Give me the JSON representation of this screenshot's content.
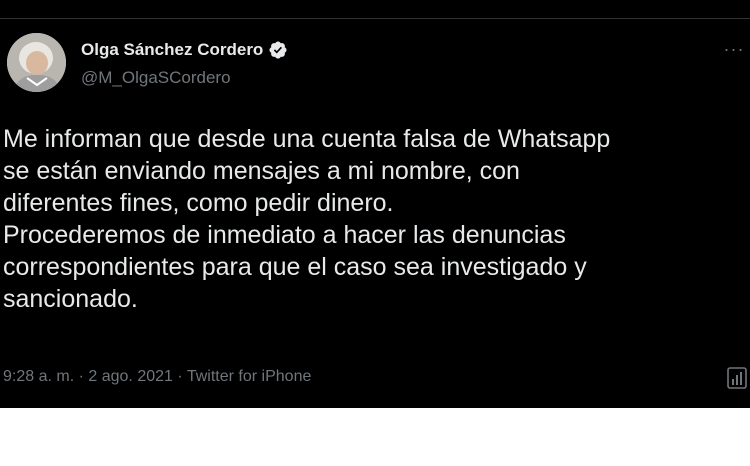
{
  "tweet": {
    "author": {
      "display_name": "Olga Sánchez Cordero",
      "handle": "@M_OlgaSCordero",
      "verified": true,
      "verified_icon": "verified-badge-icon",
      "avatar_icon": "profile-photo"
    },
    "more_icon": "more-options-icon",
    "more_label": "···",
    "text": "Me informan que desde una cuenta falsa de Whatsapp\nse están enviando mensajes a mi nombre, con\ndiferentes fines, como pedir dinero.\nProcederemos de inmediato a hacer las denuncias\ncorrespondientes para que el caso sea investigado y\nsancionado.",
    "time": "9:28 a. m.",
    "separator": "·",
    "date": "2 ago. 2021",
    "source": "Twitter for iPhone",
    "analytics_icon": "analytics-icon"
  },
  "colors": {
    "background": "#000000",
    "text_primary": "#e7e9ea",
    "text_secondary": "#71767b",
    "divider": "#2f3336",
    "page_background": "#ffffff"
  }
}
